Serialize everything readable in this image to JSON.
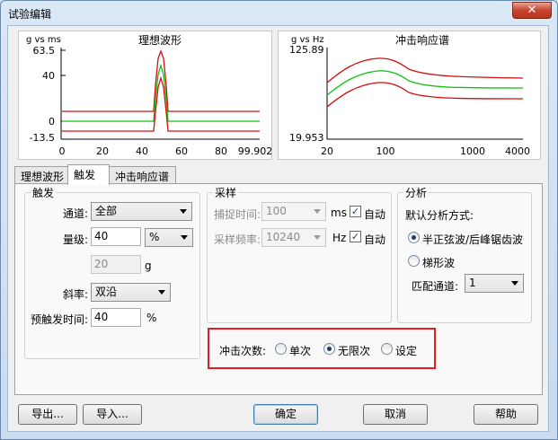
{
  "window": {
    "title": "试验编辑",
    "close_glyph": "✕"
  },
  "charts": {
    "ideal": {
      "title": "理想波形",
      "unit_label": "g vs ms",
      "y_ticks": [
        "63.5",
        "40",
        "0",
        "-13.5"
      ],
      "x_ticks": [
        "0",
        "20",
        "40",
        "60",
        "80",
        "99.902"
      ],
      "colors": {
        "upper": "#d01010",
        "nominal": "#10c010",
        "lower": "#d01010"
      }
    },
    "srs": {
      "title": "冲击响应谱",
      "unit_label": "g vs Hz",
      "y_ticks": [
        "125.89",
        "19.953"
      ],
      "x_ticks": [
        "20",
        "100",
        "1000",
        "4000"
      ],
      "colors": {
        "upper": "#d01010",
        "nominal": "#10c010",
        "lower": "#d01010"
      }
    }
  },
  "tabs": [
    {
      "label": "理想波形",
      "active": false
    },
    {
      "label": "触发",
      "active": true
    },
    {
      "label": "冲击响应谱",
      "active": false
    }
  ],
  "trigger": {
    "title": "触发",
    "channel_label": "通道:",
    "channel_value": "全部",
    "level_label": "量级:",
    "level_value": "40",
    "level_unit_value": "%",
    "level_g_value": "20",
    "level_g_unit": "g",
    "slope_label": "斜率:",
    "slope_value": "双沿",
    "pretrigger_label": "预触发时间:",
    "pretrigger_value": "40",
    "pretrigger_unit": "%"
  },
  "sampling": {
    "title": "采样",
    "capture_label": "捕捉时间:",
    "capture_value": "100",
    "capture_unit": "ms",
    "capture_auto_label": "自动",
    "capture_auto_checked": true,
    "freq_label": "采样频率:",
    "freq_value": "10240",
    "freq_unit": "Hz",
    "freq_auto_label": "自动",
    "freq_auto_checked": true
  },
  "analysis": {
    "title": "分析",
    "method_label": "默认分析方式:",
    "option_half_sine": "半正弦波/后峰锯齿波",
    "option_trapezoid": "梯形波",
    "selected": "half_sine",
    "match_channel_label": "匹配通道:",
    "match_channel_value": "1"
  },
  "shock_count": {
    "label": "冲击次数:",
    "option_single": "单次",
    "option_infinite": "无限次",
    "option_set": "设定",
    "selected": "infinite",
    "highlight_color": "#e02020"
  },
  "buttons": {
    "export": "导出...",
    "import": "导入...",
    "ok": "确定",
    "cancel": "取消",
    "help": "帮助"
  }
}
